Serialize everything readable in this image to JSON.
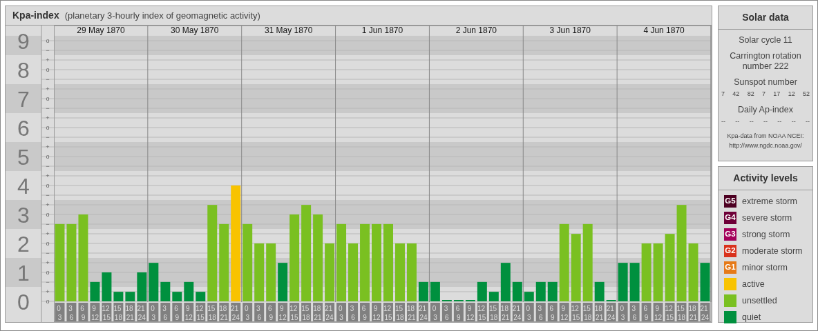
{
  "header": {
    "title": "Kpa-index",
    "subtitle": "(planetary 3-hourly index of geomagnetic activity)"
  },
  "days": [
    {
      "date": "29 May 1870"
    },
    {
      "date": "30 May 1870"
    },
    {
      "date": "31 May 1870"
    },
    {
      "date": "1 Jun 1870"
    },
    {
      "date": "2 Jun 1870"
    },
    {
      "date": "3 Jun 1870"
    },
    {
      "date": "4 Jun 1870"
    }
  ],
  "kp_scale": {
    "minor_labels": [
      "o",
      "−",
      "+",
      "o",
      "−",
      "+",
      "o",
      "−",
      "+",
      "o",
      "−",
      "+",
      "o",
      "−",
      "+",
      "o",
      "−",
      "+",
      "o",
      "−",
      "+",
      "o",
      "−",
      "+",
      "o",
      "−",
      "+",
      "o"
    ]
  },
  "chart_data": {
    "type": "bar",
    "grid": true,
    "ylim": [
      0,
      9
    ],
    "bands": [
      {
        "axis": "y",
        "from": 0.5,
        "to": 1.5
      },
      {
        "axis": "y",
        "from": 2.5,
        "to": 3.5
      },
      {
        "axis": "y",
        "from": 4.5,
        "to": 5.5
      },
      {
        "axis": "y",
        "from": 6.5,
        "to": 7.5
      },
      {
        "axis": "y",
        "from": 8.5,
        "to": 9.17
      }
    ],
    "yticks": [
      {
        "value": 0,
        "label": "0"
      },
      {
        "value": 1,
        "label": "1"
      },
      {
        "value": 2,
        "label": "2"
      },
      {
        "value": 3,
        "label": "3"
      },
      {
        "value": 4,
        "label": "4"
      },
      {
        "value": 5,
        "label": "5"
      },
      {
        "value": 6,
        "label": "6"
      },
      {
        "value": 7,
        "label": "7"
      },
      {
        "value": 8,
        "label": "8"
      },
      {
        "value": 9,
        "label": "9"
      }
    ],
    "categories": [
      "0 3",
      "3 6",
      "6 9",
      "9 12",
      "12 15",
      "15 18",
      "18 21",
      "21 24",
      "0 3",
      "3 6",
      "6 9",
      "9 12",
      "12 15",
      "15 18",
      "18 21",
      "21 24",
      "0 3",
      "3 6",
      "6 9",
      "9 12",
      "12 15",
      "15 18",
      "18 21",
      "21 24",
      "0 3",
      "3 6",
      "6 9",
      "9 12",
      "12 15",
      "15 18",
      "18 21",
      "21 24",
      "0 3",
      "3 6",
      "6 9",
      "9 12",
      "12 15",
      "15 18",
      "18 21",
      "21 24",
      "0 3",
      "3 6",
      "6 9",
      "9 12",
      "12 15",
      "15 18",
      "18 21",
      "21 24",
      "0 3",
      "3 6",
      "6 9",
      "9 12",
      "12 15",
      "15 18",
      "18 21",
      "21 24"
    ],
    "series": [
      {
        "name": "active",
        "color": "#f8c300",
        "values": [
          null,
          null,
          null,
          null,
          null,
          null,
          null,
          null,
          null,
          null,
          null,
          null,
          null,
          null,
          null,
          4,
          null,
          null,
          null,
          null,
          null,
          null,
          null,
          null,
          null,
          null,
          null,
          null,
          null,
          null,
          null,
          null,
          null,
          null,
          null,
          null,
          null,
          null,
          null,
          null,
          null,
          null,
          null,
          null,
          null,
          null,
          null,
          null,
          null,
          null,
          null,
          null,
          null,
          null,
          null,
          null
        ]
      },
      {
        "name": "unsettled",
        "color": "#7ac021",
        "values": [
          2.67,
          2.67,
          3,
          null,
          null,
          null,
          null,
          null,
          null,
          null,
          null,
          null,
          null,
          3.33,
          2.67,
          null,
          2.67,
          2,
          2,
          null,
          3,
          3.33,
          3,
          2,
          2.67,
          2,
          2.67,
          2.67,
          2.67,
          2,
          2,
          null,
          null,
          null,
          null,
          null,
          null,
          null,
          null,
          null,
          null,
          null,
          null,
          2.67,
          2.33,
          2.67,
          null,
          null,
          null,
          null,
          2,
          2,
          2.33,
          3.33,
          2,
          null
        ]
      },
      {
        "name": "quiet",
        "color": "#00903e",
        "values": [
          null,
          null,
          null,
          0.67,
          1,
          0.33,
          0.33,
          1,
          1.33,
          0.67,
          0.33,
          0.67,
          0.33,
          null,
          null,
          null,
          null,
          null,
          null,
          1.33,
          null,
          null,
          null,
          null,
          null,
          null,
          null,
          null,
          null,
          null,
          null,
          0.67,
          0.67,
          0,
          0,
          0,
          0.67,
          0.33,
          1.33,
          0.67,
          0.33,
          0.67,
          0.67,
          null,
          null,
          null,
          0.67,
          0,
          1.33,
          1.33,
          null,
          null,
          null,
          null,
          null,
          1.33
        ]
      }
    ]
  },
  "solar_data": {
    "title": "Solar data",
    "solar_cycle": "Solar cycle 11",
    "carrington": "Carrington rotation number 222",
    "sunspot_label": "Sunspot number",
    "sunspot_numbers": [
      "7",
      "42",
      "82",
      "7",
      "17",
      "12",
      "52"
    ],
    "ap_label": "Daily Ap-index",
    "ap_values": [
      "--",
      "--",
      "--",
      "--",
      "--",
      "--",
      "--"
    ],
    "source": "Kpa-data from NOAA NCEI:",
    "source_url": "http://www.ngdc.noaa.gov/"
  },
  "activity_levels": {
    "title": "Activity levels",
    "items": [
      {
        "badge": "G5",
        "label": "extreme storm",
        "color": "#4d0022"
      },
      {
        "badge": "G4",
        "label": "severe storm",
        "color": "#6e0038"
      },
      {
        "badge": "G3",
        "label": "strong storm",
        "color": "#a3005a"
      },
      {
        "badge": "G2",
        "label": "moderate storm",
        "color": "#d9321c"
      },
      {
        "badge": "G1",
        "label": "minor storm",
        "color": "#e67a18"
      }
    ]
  }
}
